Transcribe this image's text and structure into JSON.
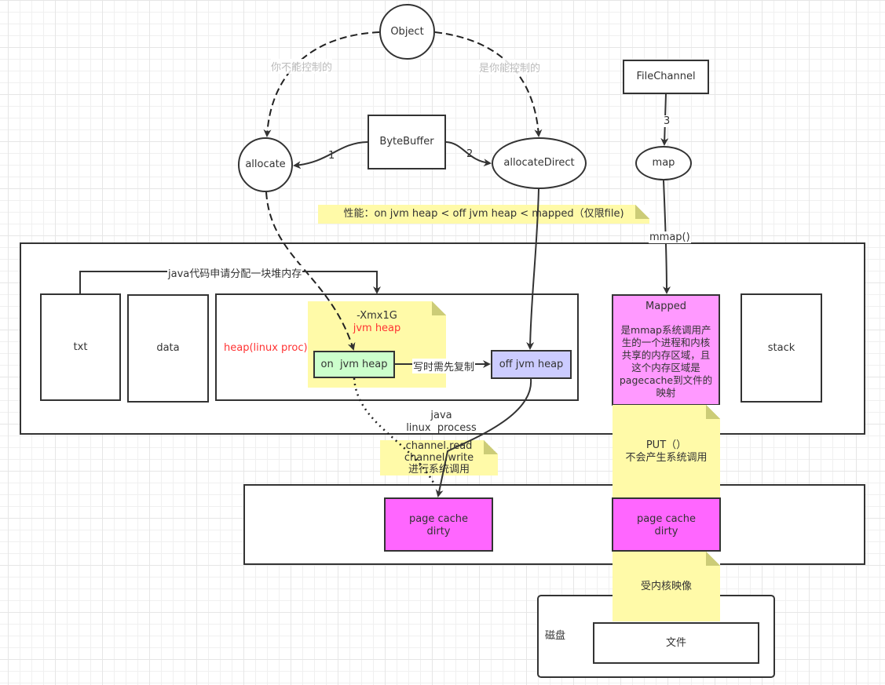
{
  "nodes": {
    "object": "Object",
    "bytebuffer": "ByteBuffer",
    "allocate": "allocate",
    "allocate_direct": "allocateDirect",
    "filechannel": "FileChannel",
    "map": "map",
    "txt": "txt",
    "data": "data",
    "heap_linux_proc": "heap(linux proc)",
    "on_jvm_heap": "on  jvm heap",
    "off_jvm_heap": "off jvm heap",
    "stack": "stack",
    "mapped_title": "Mapped",
    "mapped_desc": "是mmap系统调用产生的一个进程和内核共享的内存区域，且这个内存区域是pagecache到文件的映射",
    "page_cache_left": [
      "page cache",
      "dirty"
    ],
    "page_cache_right": [
      "page cache",
      "dirty"
    ],
    "disk_label": "磁盘",
    "file": "文件",
    "java_linux_process": [
      "java",
      "linux  process"
    ]
  },
  "edge_labels": {
    "uncontrollable": "你不能控制的",
    "controllable": "是你能控制的",
    "one": "1",
    "two": "2",
    "three": "3",
    "mmap": "mmap()",
    "java_alloc": "java代码申请分配一块堆内存",
    "copy_on_write": "写时需先复制"
  },
  "notes": {
    "performance": "性能：on jvm heap  <  off jvm heap  <  mapped（仅限file)",
    "xmx": "-Xmx1G",
    "jvm_heap": "jvm  heap",
    "channel": [
      "channel.read",
      "channel.write",
      "进行系统调用"
    ],
    "put": [
      "PUT（）",
      "不会产生系统调用"
    ],
    "kernel_mapping": "受内核映像"
  },
  "colors": {
    "note_yellow": "#fffaa8",
    "on_heap_green": "#ccffcc",
    "off_heap_blue": "#ccccff",
    "mapped_pink": "#ff99ff",
    "page_cache_magenta": "#ff66ff",
    "red_text": "#ff3333"
  }
}
